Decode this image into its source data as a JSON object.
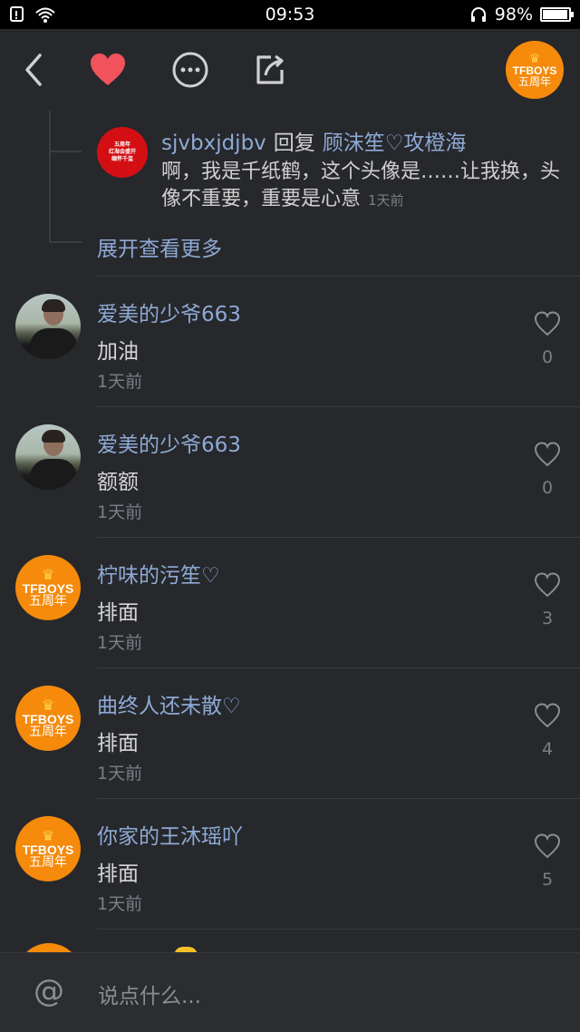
{
  "status_bar": {
    "time": "09:53",
    "battery": "98%",
    "battery_level": 0.98
  },
  "nav": {
    "back_icon": "chevron-left-icon",
    "like_icon": "heart-icon",
    "more_icon": "more-dots-icon",
    "share_icon": "share-icon",
    "avatar": {
      "line1": "TFBOYS",
      "line2": "五周年"
    }
  },
  "reply": {
    "avatar_text": [
      "五周年",
      "红海会盛开",
      "缅怀千玺"
    ],
    "user": "sjvbxjdjbv",
    "reply_word": "回复",
    "target": "顾沫笙♡攻橙海",
    "body": "啊，我是千纸鹤，这个头像是……让我换，头像不重要，重要是心意",
    "time": "1天前",
    "expand_label": "展开查看更多"
  },
  "comments": [
    {
      "name": "爱美的少爷663",
      "text": "加油",
      "time": "1天前",
      "likes": "0",
      "avatar": "photo"
    },
    {
      "name": "爱美的少爷663",
      "text": "额额",
      "time": "1天前",
      "likes": "0",
      "avatar": "photo"
    },
    {
      "name": "柠味的污笙♡",
      "text": "排面",
      "time": "1天前",
      "likes": "3",
      "avatar": "tfboys"
    },
    {
      "name": "曲终人还未散♡",
      "text": "排面",
      "time": "1天前",
      "likes": "4",
      "avatar": "tfboys"
    },
    {
      "name": "你家的王沐瑶吖",
      "text": "排面",
      "time": "1天前",
      "likes": "5",
      "avatar": "tfboys"
    }
  ],
  "input": {
    "at_symbol": "@",
    "placeholder": "说点什么..."
  },
  "colors": {
    "background": "#26282c",
    "username": "#8ea9d4",
    "heart": "#f0535b",
    "tfboys_orange": "#f58a0b"
  }
}
